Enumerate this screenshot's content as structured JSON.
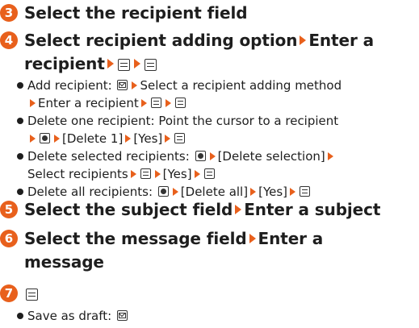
{
  "steps": {
    "s3": {
      "num": "3",
      "text": "Select the recipient field"
    },
    "s4": {
      "num": "4",
      "line1_a": "Select recipient adding option",
      "line1_b": "Enter a",
      "line2": "recipient"
    },
    "s5": {
      "num": "5",
      "a": "Select the subject field",
      "b": "Enter a subject"
    },
    "s6": {
      "num": "6",
      "a": "Select the message field",
      "b": "Enter a",
      "line2": "message"
    },
    "s7": {
      "num": "7"
    }
  },
  "bullets4": {
    "add": {
      "a": "Add recipient:",
      "b": "Select a recipient adding method",
      "c": "Enter a recipient"
    },
    "del1": {
      "a": "Delete one recipient: Point the cursor to a recipient",
      "b": "[Delete 1]",
      "c": "[Yes]"
    },
    "delsel": {
      "a": "Delete selected recipients:",
      "b": "[Delete selection]",
      "c": "Select recipients",
      "d": "[Yes]"
    },
    "delall": {
      "a": "Delete all recipients:",
      "b": "[Delete all]",
      "c": "[Yes]"
    }
  },
  "bullets7": {
    "draft": {
      "a": "Save as draft:"
    }
  },
  "icons": {
    "step_number_color": "#e8601c",
    "arrow_color": "#e8601c",
    "arrow": "right-triangle",
    "keys": [
      "center-key-icon",
      "menu-key-icon",
      "mail-key-icon"
    ]
  }
}
